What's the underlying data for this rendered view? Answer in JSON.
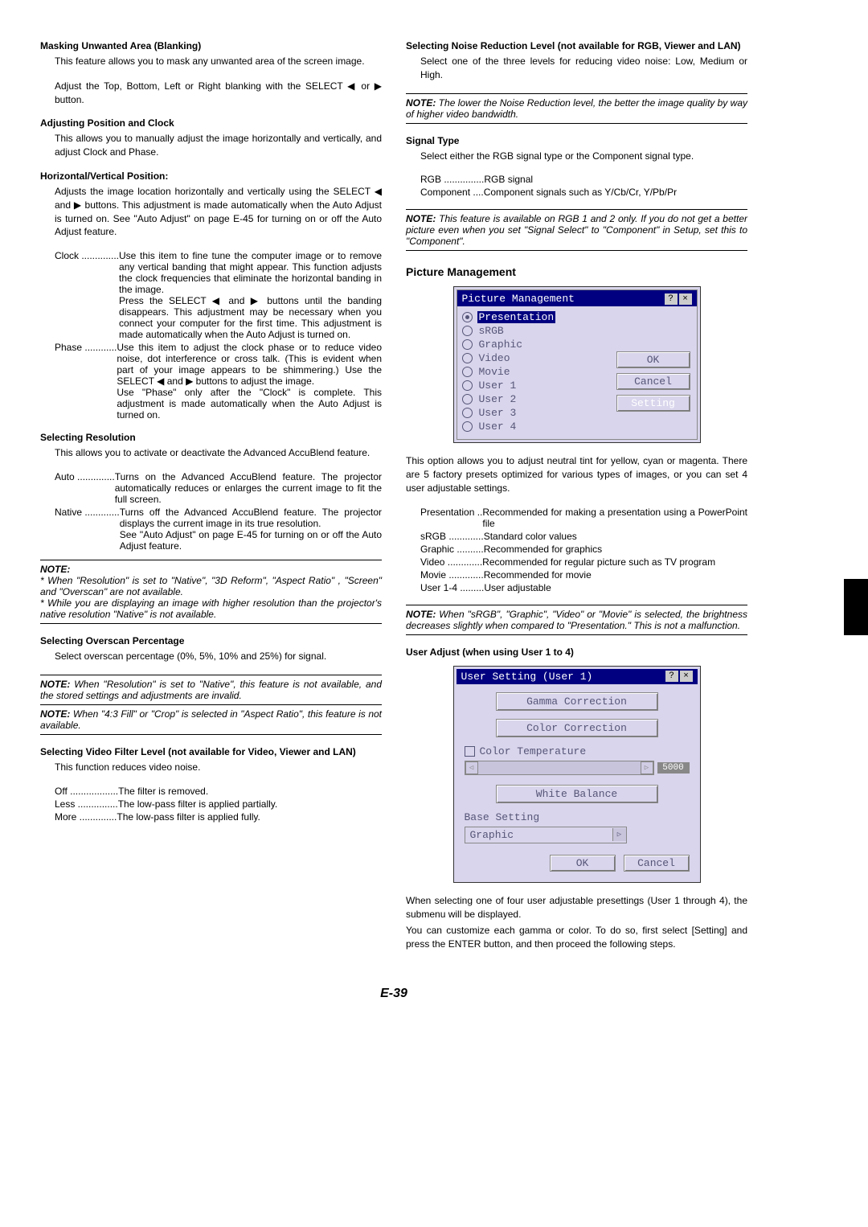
{
  "page_number": "E-39",
  "left": {
    "blanking": {
      "title": "Masking Unwanted Area (Blanking)",
      "p1": "This feature allows you to mask any unwanted area of the screen image.",
      "p2": "Adjust the Top, Bottom, Left or Right blanking with the SELECT ◀ or ▶ button."
    },
    "posclock": {
      "title": "Adjusting Position and Clock",
      "p1": "This allows you to manually adjust the image horizontally and vertically, and adjust Clock and Phase."
    },
    "hvpos": {
      "title": "Horizontal/Vertical Position:",
      "p1": "Adjusts the image location horizontally and vertically using the SELECT ◀ and ▶ buttons. This adjustment is made automatically when the Auto Adjust is turned on. See \"Auto Adjust\" on page E-45 for turning on or off the Auto Adjust feature.",
      "clock_term": "Clock ..............",
      "clock_desc": "Use this item to fine tune the computer image or to remove any vertical banding that might appear. This function adjusts the clock frequencies that eliminate the horizontal banding in the image.\nPress the SELECT ◀ and ▶ buttons until the banding disappears. This adjustment may be necessary when you connect your computer for the first time. This adjustment is made automatically when the Auto Adjust is turned on.",
      "phase_term": "Phase ............",
      "phase_desc": "Use this item to adjust the clock phase or to reduce video noise, dot interference or cross talk. (This is evident when part of your image appears to be shimmering.) Use the SELECT ◀ and ▶ buttons to adjust the image.\nUse \"Phase\" only after the \"Clock\" is complete. This adjustment is made automatically when the Auto Adjust is turned on."
    },
    "resolution": {
      "title": "Selecting Resolution",
      "p1": "This allows you to activate or deactivate the Advanced AccuBlend feature.",
      "auto_term": "Auto ..............",
      "auto_desc": "Turns on the Advanced AccuBlend feature. The projector automatically reduces or enlarges the current image to fit the full screen.",
      "native_term": "Native .............",
      "native_desc": "Turns off the Advanced AccuBlend feature. The projector displays the current image in its true resolution.\nSee \"Auto Adjust\" on page E-45 for turning on or off the Auto Adjust feature.",
      "note_label": "NOTE:",
      "note1": "* When \"Resolution\" is set to \"Native\", \"3D Reform\", \"Aspect Ratio\" , \"Screen\" and \"Overscan\" are not available.",
      "note2": "* While you are displaying an image with higher resolution than the projector's native resolution \"Native\" is not available."
    },
    "overscan": {
      "title": "Selecting Overscan Percentage",
      "p1": "Select overscan percentage (0%, 5%, 10% and 25%) for signal.",
      "note1_label": "NOTE:",
      "note1": " When \"Resolution\" is set to \"Native\", this feature is not available, and the stored settings and adjustments are invalid.",
      "note2_label": "NOTE:",
      "note2": " When \"4:3 Fill\" or \"Crop\" is selected in \"Aspect Ratio\", this feature is not available."
    },
    "videofilter": {
      "title": "Selecting Video Filter Level (not available for Video, Viewer and LAN)",
      "p1": "This function reduces video noise.",
      "off_term": "Off ..................",
      "off_desc": "The filter is removed.",
      "less_term": "Less ...............",
      "less_desc": "The low-pass filter is applied partially.",
      "more_term": "More ..............",
      "more_desc": "The low-pass filter is applied fully."
    }
  },
  "right": {
    "noise": {
      "title": "Selecting Noise Reduction Level (not available for RGB, Viewer and LAN)",
      "p1": "Select one of the three levels for reducing video noise: Low, Medium or High.",
      "note_label": "NOTE:",
      "note": " The lower the Noise Reduction level, the better the image quality by way of higher video bandwidth."
    },
    "signal": {
      "title": "Signal Type",
      "p1": "Select either the RGB signal type or the Component signal type.",
      "rgb_term": "RGB ...............",
      "rgb_desc": "RGB signal",
      "comp_term": "Component ....",
      "comp_desc": "Component signals such as Y/Cb/Cr, Y/Pb/Pr",
      "note_label": "NOTE:",
      "note": " This feature is available on RGB 1 and 2 only. If you do not get a better picture even when you set \"Signal Select\" to \"Component\" in Setup, set this to \"Component\"."
    },
    "pm": {
      "heading": "Picture Management",
      "dialog_title": "Picture Management",
      "options": [
        "Presentation",
        "sRGB",
        "Graphic",
        "Video",
        "Movie",
        "User 1",
        "User 2",
        "User 3",
        "User 4"
      ],
      "ok": "OK",
      "cancel": "Cancel",
      "setting": "Setting",
      "p1": "This option allows you to adjust neutral tint for yellow, cyan or magenta. There are 5 factory presets optimized for various types of images, or you can set 4 user adjustable settings.",
      "rows": {
        "presentation_term": "Presentation ..",
        "presentation_desc": "Recommended for making a presentation using a PowerPoint file",
        "srgb_term": "sRGB .............",
        "srgb_desc": "Standard color values",
        "graphic_term": "Graphic ..........",
        "graphic_desc": "Recommended for graphics",
        "video_term": "Video .............",
        "video_desc": "Recommended for regular picture such as TV program",
        "movie_term": "Movie .............",
        "movie_desc": "Recommended for movie",
        "user_term": "User 1-4 .........",
        "user_desc": "User adjustable"
      },
      "note_label": "NOTE:",
      "note": " When \"sRGB\", \"Graphic\", \"Video\" or \"Movie\" is selected, the brightness decreases slightly when compared to \"Presentation.\" This is not a malfunction."
    },
    "useradj": {
      "title": "User Adjust (when using User 1 to 4)",
      "dialog_title": "User Setting (User 1)",
      "gamma": "Gamma Correction",
      "color_corr": "Color Correction",
      "color_temp": "Color Temperature",
      "slider_value": "5000",
      "white_balance": "White Balance",
      "base_setting": "Base Setting",
      "base_value": "Graphic",
      "ok": "OK",
      "cancel": "Cancel",
      "p1": "When selecting one of four user adjustable presettings (User 1 through 4), the submenu will be displayed.",
      "p2": "You can customize each gamma or color. To do so, first select [Setting] and press the ENTER button, and then proceed the following steps."
    }
  }
}
